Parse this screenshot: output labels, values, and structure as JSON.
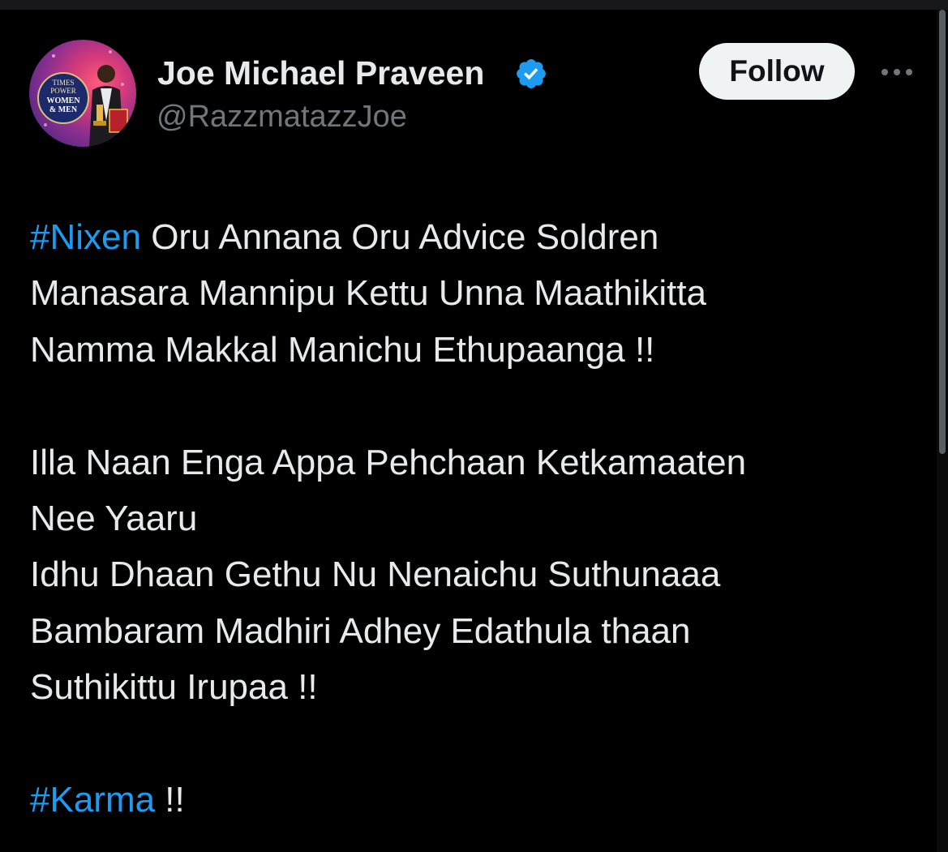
{
  "tweet": {
    "author": {
      "name": "Joe Michael Praveen",
      "handle": "@RazzmatazzJoe",
      "verified": true,
      "avatar_text": [
        "TIMES",
        "POWER",
        "WOMEN",
        "& MEN"
      ]
    },
    "follow_label": "Follow",
    "more_icon": "more-horizontal-icon",
    "lines": [
      {
        "hashtag": "#Nixen",
        "text": " Oru Annana Oru Advice Soldren"
      },
      {
        "hashtag": "",
        "text": "Manasara Mannipu Kettu Unna Maathikitta"
      },
      {
        "hashtag": "",
        "text": "Namma Makkal Manichu Ethupaanga !!"
      },
      {
        "hashtag": "",
        "text": ""
      },
      {
        "hashtag": "",
        "text": "Illa Naan Enga Appa Pehchaan Ketkamaaten"
      },
      {
        "hashtag": "",
        "text": "Nee Yaaru"
      },
      {
        "hashtag": "",
        "text": "Idhu Dhaan Gethu Nu Nenaichu Suthunaaa"
      },
      {
        "hashtag": "",
        "text": "Bambaram Madhiri Adhey Edathula thaan"
      },
      {
        "hashtag": "",
        "text": "Suthikittu Irupaa !!"
      },
      {
        "hashtag": "",
        "text": ""
      },
      {
        "hashtag": "#Karma",
        "text": " !!"
      }
    ]
  },
  "colors": {
    "background": "#000000",
    "primary_text": "#e7e9ea",
    "secondary_text": "#71767b",
    "hashtag": "#1d9bf0",
    "verified_badge": "#1d9bf0",
    "follow_bg": "#eff3f4",
    "follow_text": "#0f1419"
  }
}
